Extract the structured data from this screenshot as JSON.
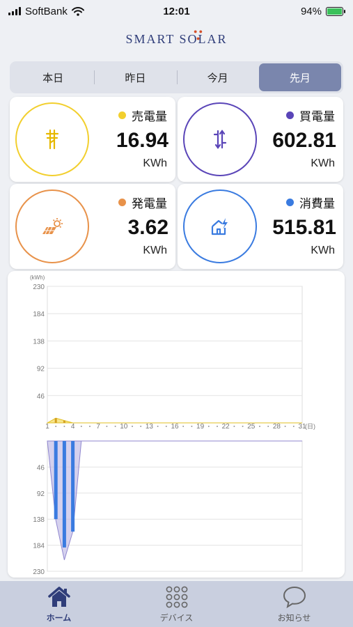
{
  "status_bar": {
    "carrier": "SoftBank",
    "time": "12:01",
    "battery": "94%"
  },
  "logo": {
    "text": "SMART SOLAR"
  },
  "segments": [
    {
      "label": "本日",
      "active": false
    },
    {
      "label": "昨日",
      "active": false
    },
    {
      "label": "今月",
      "active": false
    },
    {
      "label": "先月",
      "active": true
    }
  ],
  "cards": {
    "sell": {
      "label": "売電量",
      "value": "16.94",
      "unit": "KWh",
      "color": "#f2cf2e",
      "icon": "power-pole-icon"
    },
    "buy": {
      "label": "買電量",
      "value": "602.81",
      "unit": "KWh",
      "color": "#5a45b8",
      "icon": "transfer-icon"
    },
    "generate": {
      "label": "発電量",
      "value": "3.62",
      "unit": "KWh",
      "color": "#e8924a",
      "icon": "solar-panel-icon"
    },
    "consume": {
      "label": "消費量",
      "value": "515.81",
      "unit": "KWh",
      "color": "#3a7be0",
      "icon": "house-bolt-icon"
    }
  },
  "chart_data": {
    "type": "bar",
    "ylabel": "(kWh)",
    "xlabel": "(日)",
    "ylim_top": [
      0,
      230
    ],
    "ylim_bottom": [
      0,
      230
    ],
    "y_ticks_top": [
      "230",
      "184",
      "138",
      "92",
      "46"
    ],
    "y_ticks_bottom": [
      "46",
      "92",
      "138",
      "184",
      "230"
    ],
    "x_ticks": [
      "1",
      "4",
      "7",
      "10",
      "13",
      "16",
      "19",
      "22",
      "25",
      "28",
      "31"
    ],
    "days": 31,
    "series": [
      {
        "name": "売電量",
        "color": "#f2cf2e",
        "direction": "up",
        "values": [
          0,
          8,
          4,
          0,
          0,
          0,
          0,
          0,
          0,
          0,
          0,
          0,
          0,
          0,
          0,
          0,
          0,
          0,
          0,
          0,
          0,
          0,
          0,
          0,
          0,
          0,
          0,
          0,
          0,
          0,
          0
        ]
      },
      {
        "name": "買電量",
        "color": "#b9b2e2",
        "direction": "down",
        "values": [
          0,
          140,
          210,
          160,
          0,
          0,
          0,
          0,
          0,
          0,
          0,
          0,
          0,
          0,
          0,
          0,
          0,
          0,
          0,
          0,
          0,
          0,
          0,
          0,
          0,
          0,
          0,
          0,
          0,
          0,
          0
        ]
      },
      {
        "name": "消費量",
        "color": "#3a7be0",
        "direction": "down",
        "values": [
          0,
          138,
          188,
          160,
          0,
          0,
          0,
          0,
          0,
          0,
          0,
          0,
          0,
          0,
          0,
          0,
          0,
          0,
          0,
          0,
          0,
          0,
          0,
          0,
          0,
          0,
          0,
          0,
          0,
          0,
          0
        ]
      }
    ]
  },
  "tabbar": [
    {
      "label": "ホーム",
      "icon": "home-icon",
      "active": true
    },
    {
      "label": "デバイス",
      "icon": "grid-dots-icon",
      "active": false
    },
    {
      "label": "お知らせ",
      "icon": "chat-bubble-icon",
      "active": false
    }
  ]
}
